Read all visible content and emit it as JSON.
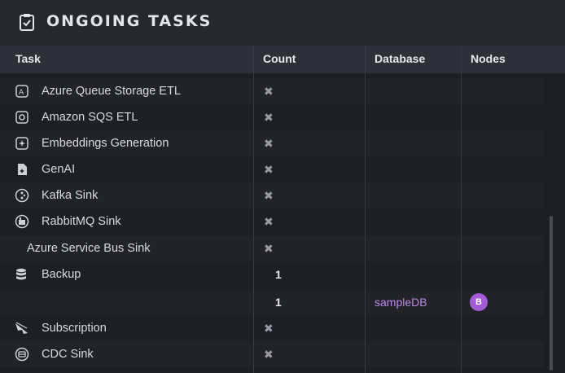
{
  "header": {
    "title": "ONGOING TASKS",
    "icon": "clipboard-check-icon"
  },
  "columns": {
    "task": "Task",
    "count": "Count",
    "database": "Database",
    "nodes": "Nodes"
  },
  "rows": [
    {
      "task": "Azure Queue Storage ETL",
      "icon": "azure-queue-icon",
      "count": "✖"
    },
    {
      "task": "Amazon SQS ETL",
      "icon": "sqs-icon",
      "count": "✖"
    },
    {
      "task": "Embeddings Generation",
      "icon": "embeddings-icon",
      "count": "✖"
    },
    {
      "task": "GenAI",
      "icon": "genai-icon",
      "count": "✖"
    },
    {
      "task": "Kafka Sink",
      "icon": "kafka-icon",
      "count": "✖"
    },
    {
      "task": "RabbitMQ Sink",
      "icon": "rabbitmq-icon",
      "count": "✖"
    },
    {
      "task": "Azure Service Bus Sink",
      "icon": "",
      "count": "✖"
    },
    {
      "task": "Backup",
      "icon": "backup-icon",
      "count": "1"
    },
    {
      "task": "",
      "icon": "",
      "count": "1",
      "database": "sampleDB",
      "node": "B"
    },
    {
      "task": "Subscription",
      "icon": "subscription-icon",
      "count": "✖"
    },
    {
      "task": "CDC Sink",
      "icon": "cdc-sink-icon",
      "count": "✖"
    }
  ],
  "colors": {
    "accent": "#b88be6",
    "badge": "#a35bd8"
  }
}
